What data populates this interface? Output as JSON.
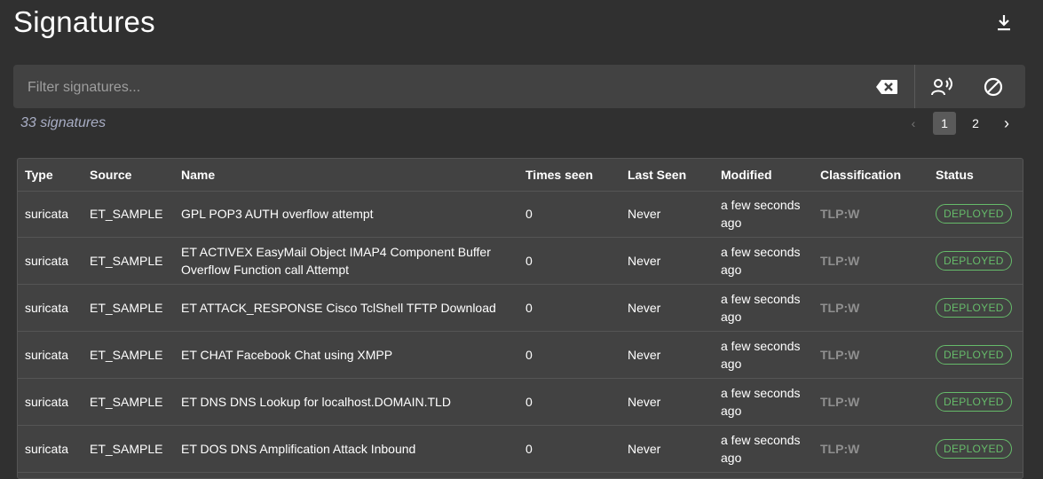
{
  "page": {
    "title": "Signatures"
  },
  "toolbar": {
    "download_icon": "download-icon",
    "clear_icon": "backspace-clear-icon",
    "assignee_icon": "person-voice-icon",
    "block_icon": "block-icon"
  },
  "search": {
    "placeholder": "Filter signatures...",
    "value": ""
  },
  "summary": {
    "count_text": "33 signatures"
  },
  "pagination": {
    "prev": "‹",
    "pages": [
      "1",
      "2"
    ],
    "current": "1",
    "next": "›"
  },
  "table": {
    "headers": [
      "Type",
      "Source",
      "Name",
      "Times seen",
      "Last Seen",
      "Modified",
      "Classification",
      "Status"
    ],
    "rows": [
      {
        "type": "suricata",
        "source": "ET_SAMPLE",
        "name": "GPL POP3 AUTH overflow attempt",
        "times_seen": "0",
        "last_seen": "Never",
        "modified": "a few seconds ago",
        "classification": "TLP:W",
        "status": "DEPLOYED"
      },
      {
        "type": "suricata",
        "source": "ET_SAMPLE",
        "name": "ET ACTIVEX EasyMail Object IMAP4 Component Buffer Overflow Function call Attempt",
        "times_seen": "0",
        "last_seen": "Never",
        "modified": "a few seconds ago",
        "classification": "TLP:W",
        "status": "DEPLOYED"
      },
      {
        "type": "suricata",
        "source": "ET_SAMPLE",
        "name": "ET ATTACK_RESPONSE Cisco TclShell TFTP Download",
        "times_seen": "0",
        "last_seen": "Never",
        "modified": "a few seconds ago",
        "classification": "TLP:W",
        "status": "DEPLOYED"
      },
      {
        "type": "suricata",
        "source": "ET_SAMPLE",
        "name": "ET CHAT Facebook Chat using XMPP",
        "times_seen": "0",
        "last_seen": "Never",
        "modified": "a few seconds ago",
        "classification": "TLP:W",
        "status": "DEPLOYED"
      },
      {
        "type": "suricata",
        "source": "ET_SAMPLE",
        "name": "ET DNS DNS Lookup for localhost.DOMAIN.TLD",
        "times_seen": "0",
        "last_seen": "Never",
        "modified": "a few seconds ago",
        "classification": "TLP:W",
        "status": "DEPLOYED"
      },
      {
        "type": "suricata",
        "source": "ET_SAMPLE",
        "name": "ET DOS DNS Amplification Attack Inbound",
        "times_seen": "0",
        "last_seen": "Never",
        "modified": "a few seconds ago",
        "classification": "TLP:W",
        "status": "DEPLOYED"
      }
    ]
  },
  "colors": {
    "background": "#303030",
    "surface": "#424242",
    "deployed": "#66bb6a",
    "count_text": "#a8adc4"
  }
}
